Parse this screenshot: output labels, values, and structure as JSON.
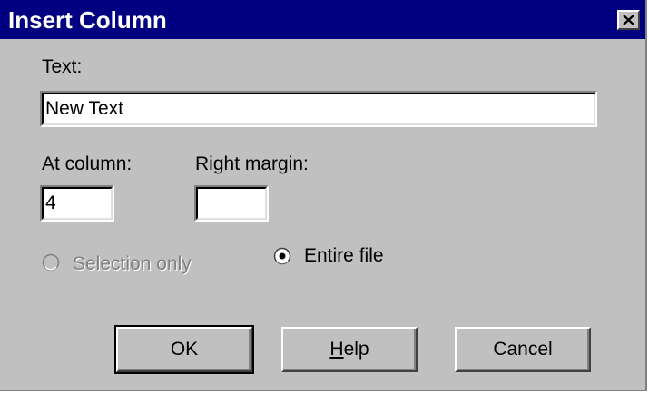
{
  "window": {
    "title": "Insert Column",
    "close_glyph": "✕"
  },
  "text_field": {
    "label": "Text:",
    "value": "New Text"
  },
  "at_column": {
    "label": "At column:",
    "value": "4"
  },
  "right_margin": {
    "label": "Right margin:",
    "value": ""
  },
  "scope": {
    "selection_only": {
      "label": "Selection only",
      "enabled": false,
      "selected": false
    },
    "entire_file": {
      "label": "Entire file",
      "enabled": true,
      "selected": true
    }
  },
  "buttons": {
    "ok": "OK",
    "help_mnemonic": "H",
    "help_rest": "elp",
    "cancel": "Cancel"
  },
  "colors": {
    "titlebar": "#000080",
    "face": "#c0c0c0",
    "disabled_text": "#808080"
  }
}
